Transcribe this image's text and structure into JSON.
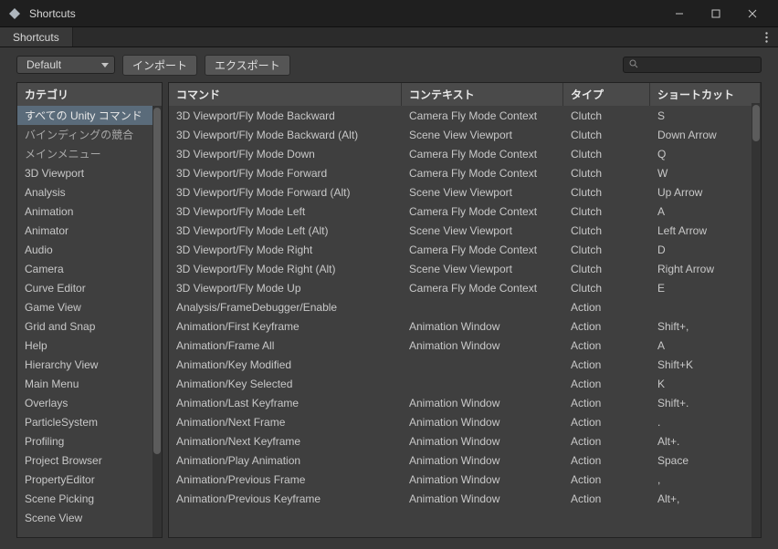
{
  "window": {
    "title": "Shortcuts"
  },
  "tab": {
    "label": "Shortcuts"
  },
  "toolbar": {
    "profile": "Default",
    "import": "インポート",
    "export": "エクスポート",
    "search_placeholder": ""
  },
  "sidebar": {
    "header": "カテゴリ",
    "items": [
      {
        "label": "すべての Unity コマンド",
        "selected": true
      },
      {
        "label": "バインディングの競合",
        "alt": true
      },
      {
        "label": "メインメニュー",
        "alt": true
      },
      {
        "label": "3D Viewport"
      },
      {
        "label": "Analysis"
      },
      {
        "label": "Animation"
      },
      {
        "label": "Animator"
      },
      {
        "label": "Audio"
      },
      {
        "label": "Camera"
      },
      {
        "label": "Curve Editor"
      },
      {
        "label": "Game View"
      },
      {
        "label": "Grid and Snap"
      },
      {
        "label": "Help"
      },
      {
        "label": "Hierarchy View"
      },
      {
        "label": "Main Menu"
      },
      {
        "label": "Overlays"
      },
      {
        "label": "ParticleSystem"
      },
      {
        "label": "Profiling"
      },
      {
        "label": "Project Browser"
      },
      {
        "label": "PropertyEditor"
      },
      {
        "label": "Scene Picking"
      },
      {
        "label": "Scene View"
      }
    ]
  },
  "table": {
    "headers": {
      "command": "コマンド",
      "context": "コンテキスト",
      "type": "タイプ",
      "shortcut": "ショートカット"
    },
    "rows": [
      {
        "command": "3D Viewport/Fly Mode Backward",
        "context": "Camera Fly Mode Context",
        "type": "Clutch",
        "shortcut": "S"
      },
      {
        "command": "3D Viewport/Fly Mode Backward (Alt)",
        "context": "Scene View Viewport",
        "type": "Clutch",
        "shortcut": "Down Arrow"
      },
      {
        "command": "3D Viewport/Fly Mode Down",
        "context": "Camera Fly Mode Context",
        "type": "Clutch",
        "shortcut": "Q"
      },
      {
        "command": "3D Viewport/Fly Mode Forward",
        "context": "Camera Fly Mode Context",
        "type": "Clutch",
        "shortcut": "W"
      },
      {
        "command": "3D Viewport/Fly Mode Forward (Alt)",
        "context": "Scene View Viewport",
        "type": "Clutch",
        "shortcut": "Up Arrow"
      },
      {
        "command": "3D Viewport/Fly Mode Left",
        "context": "Camera Fly Mode Context",
        "type": "Clutch",
        "shortcut": "A"
      },
      {
        "command": "3D Viewport/Fly Mode Left (Alt)",
        "context": "Scene View Viewport",
        "type": "Clutch",
        "shortcut": "Left Arrow"
      },
      {
        "command": "3D Viewport/Fly Mode Right",
        "context": "Camera Fly Mode Context",
        "type": "Clutch",
        "shortcut": "D"
      },
      {
        "command": "3D Viewport/Fly Mode Right (Alt)",
        "context": "Scene View Viewport",
        "type": "Clutch",
        "shortcut": "Right Arrow"
      },
      {
        "command": "3D Viewport/Fly Mode Up",
        "context": "Camera Fly Mode Context",
        "type": "Clutch",
        "shortcut": "E"
      },
      {
        "command": "Analysis/FrameDebugger/Enable",
        "context": "",
        "type": "Action",
        "shortcut": ""
      },
      {
        "command": "Animation/First Keyframe",
        "context": "Animation Window",
        "type": "Action",
        "shortcut": "Shift+,"
      },
      {
        "command": "Animation/Frame All",
        "context": "Animation Window",
        "type": "Action",
        "shortcut": "A"
      },
      {
        "command": "Animation/Key Modified",
        "context": "",
        "type": "Action",
        "shortcut": "Shift+K"
      },
      {
        "command": "Animation/Key Selected",
        "context": "",
        "type": "Action",
        "shortcut": "K"
      },
      {
        "command": "Animation/Last Keyframe",
        "context": "Animation Window",
        "type": "Action",
        "shortcut": "Shift+."
      },
      {
        "command": "Animation/Next Frame",
        "context": "Animation Window",
        "type": "Action",
        "shortcut": "."
      },
      {
        "command": "Animation/Next Keyframe",
        "context": "Animation Window",
        "type": "Action",
        "shortcut": "Alt+."
      },
      {
        "command": "Animation/Play Animation",
        "context": "Animation Window",
        "type": "Action",
        "shortcut": "Space"
      },
      {
        "command": "Animation/Previous Frame",
        "context": "Animation Window",
        "type": "Action",
        "shortcut": ","
      },
      {
        "command": "Animation/Previous Keyframe",
        "context": "Animation Window",
        "type": "Action",
        "shortcut": "Alt+,"
      }
    ]
  }
}
